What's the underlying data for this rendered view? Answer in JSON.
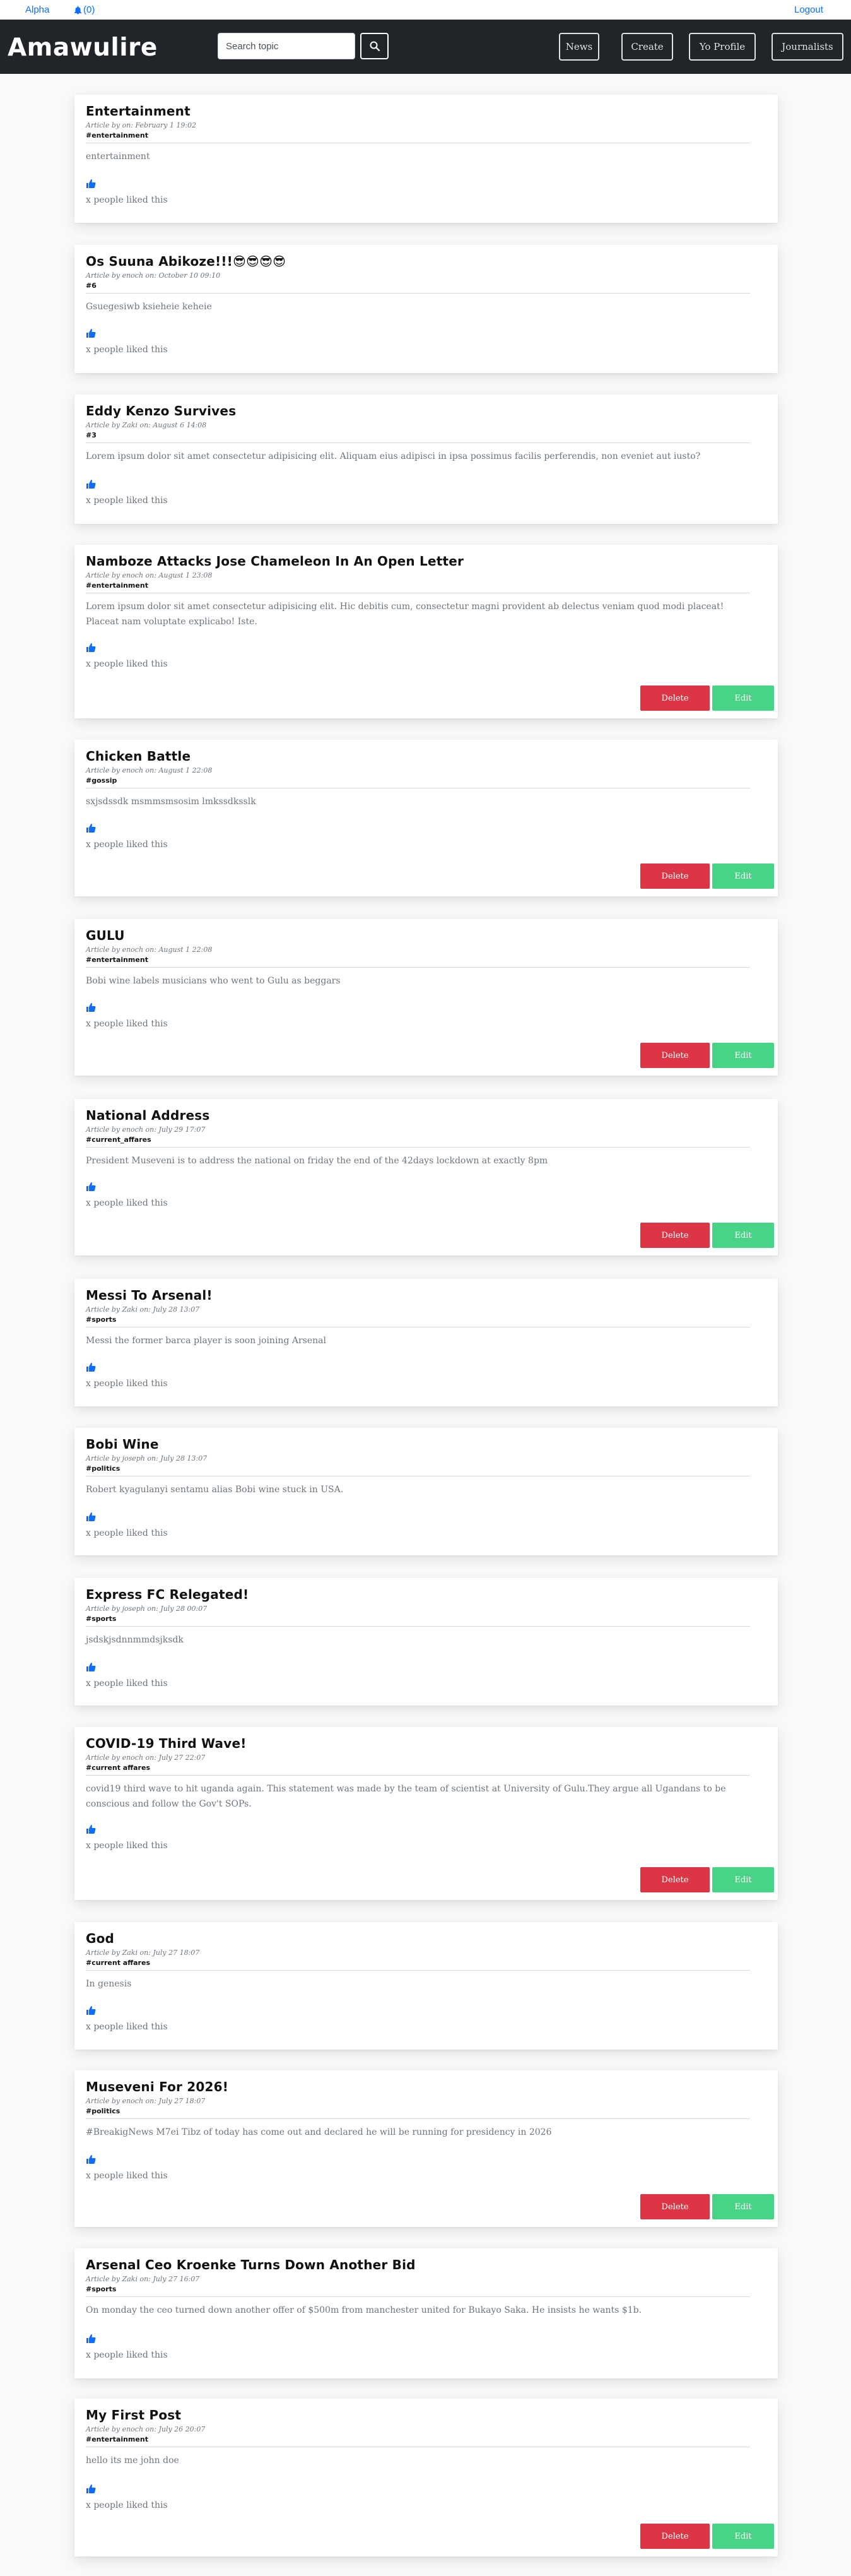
{
  "topbar": {
    "user_link": "Alpha",
    "notifications_label": "(0)",
    "logout_link": "Logout"
  },
  "navbar": {
    "brand": "Amawulire",
    "search_placeholder": "Search topic",
    "buttons": [
      "News",
      "Create",
      "Yo Profile",
      "Journalists"
    ]
  },
  "colors": {
    "navbar_bg": "#212529",
    "link": "#0d6efd",
    "like_icon": "#0d6efd",
    "delete": "#dc3545",
    "edit": "#48d486"
  },
  "card_actions": {
    "delete_label": "Delete",
    "edit_label": "Edit"
  },
  "articles": [
    {
      "title": "Entertainment",
      "meta": "Article by on: February 1 19:02",
      "tag": "#entertainment",
      "body": "entertainment",
      "likes": "x people liked this",
      "editable": false
    },
    {
      "title": "Os Suuna Abikoze!!!😎😎😎😎",
      "meta": "Article by enoch on: October 10 09:10",
      "tag": "#6",
      "body": "Gsuegesiwb ksieheie keheie",
      "likes": "x people liked this",
      "editable": false
    },
    {
      "title": "Eddy Kenzo Survives",
      "meta": "Article by Zaki on: August 6 14:08",
      "tag": "#3",
      "body": "Lorem ipsum dolor sit amet consectetur adipisicing elit. Aliquam eius adipisci in ipsa possimus facilis perferendis, non eveniet aut iusto?",
      "likes": "x people liked this",
      "editable": false
    },
    {
      "title": "Namboze Attacks Jose Chameleon In An Open Letter",
      "meta": "Article by enoch on: August 1 23:08",
      "tag": "#entertainment",
      "body": "Lorem ipsum dolor sit amet consectetur adipisicing elit. Hic debitis cum, consectetur magni provident ab delectus veniam quod modi placeat! Placeat nam voluptate explicabo! Iste.",
      "likes": "x people liked this",
      "editable": true
    },
    {
      "title": "Chicken Battle",
      "meta": "Article by enoch on: August 1 22:08",
      "tag": "#gossip",
      "body": "sxjsdssdk msmmsmsosim lmkssdksslk",
      "likes": "x people liked this",
      "editable": true
    },
    {
      "title": "GULU",
      "meta": "Article by enoch on: August 1 22:08",
      "tag": "#entertainment",
      "body": "Bobi wine labels musicians who went to Gulu as beggars",
      "likes": "x people liked this",
      "editable": true
    },
    {
      "title": "National Address",
      "meta": "Article by enoch on: July 29 17:07",
      "tag": "#current_affares",
      "body": "President Museveni is to address the national on friday the end of the 42days lockdown at exactly 8pm",
      "likes": "x people liked this",
      "editable": true
    },
    {
      "title": "Messi To Arsenal!",
      "meta": "Article by Zaki on: July 28 13:07",
      "tag": "#sports",
      "body": "Messi the former barca player is soon joining Arsenal",
      "likes": "x people liked this",
      "editable": false
    },
    {
      "title": "Bobi Wine",
      "meta": "Article by joseph on: July 28 13:07",
      "tag": "#politics",
      "body": "Robert kyagulanyi sentamu alias Bobi wine stuck in USA.",
      "likes": "x people liked this",
      "editable": false
    },
    {
      "title": "Express FC Relegated!",
      "meta": "Article by joseph on: July 28 00:07",
      "tag": "#sports",
      "body": "jsdskjsdnnmmdsjksdk",
      "likes": "x people liked this",
      "editable": false
    },
    {
      "title": "COVID-19 Third Wave!",
      "meta": "Article by enoch on: July 27 22:07",
      "tag": "#current affares",
      "body": "covid19 third wave to hit uganda again. This statement was made by the team of scientist at University of Gulu.They argue all Ugandans to be conscious and follow the Gov't SOPs.",
      "likes": "x people liked this",
      "editable": true
    },
    {
      "title": "God",
      "meta": "Article by Zaki on: July 27 18:07",
      "tag": "#current affares",
      "body": "In genesis",
      "likes": "x people liked this",
      "editable": false
    },
    {
      "title": "Museveni For 2026!",
      "meta": "Article by enoch on: July 27 18:07",
      "tag": "#politics",
      "body": "#BreakigNews M7ei Tibz of today has come out and declared he will be running for presidency in 2026",
      "likes": "x people liked this",
      "editable": true
    },
    {
      "title": "Arsenal Ceo Kroenke Turns Down Another Bid",
      "meta": "Article by Zaki on: July 27 16:07",
      "tag": "#sports",
      "body": "On monday the ceo turned down another offer of $500m from manchester united for Bukayo Saka. He insists he wants $1b.",
      "likes": "x people liked this",
      "editable": false
    },
    {
      "title": "My First Post",
      "meta": "Article by enoch on: July 26 20:07",
      "tag": "#entertainment",
      "body": "hello its me john doe",
      "likes": "x people liked this",
      "editable": true
    }
  ]
}
